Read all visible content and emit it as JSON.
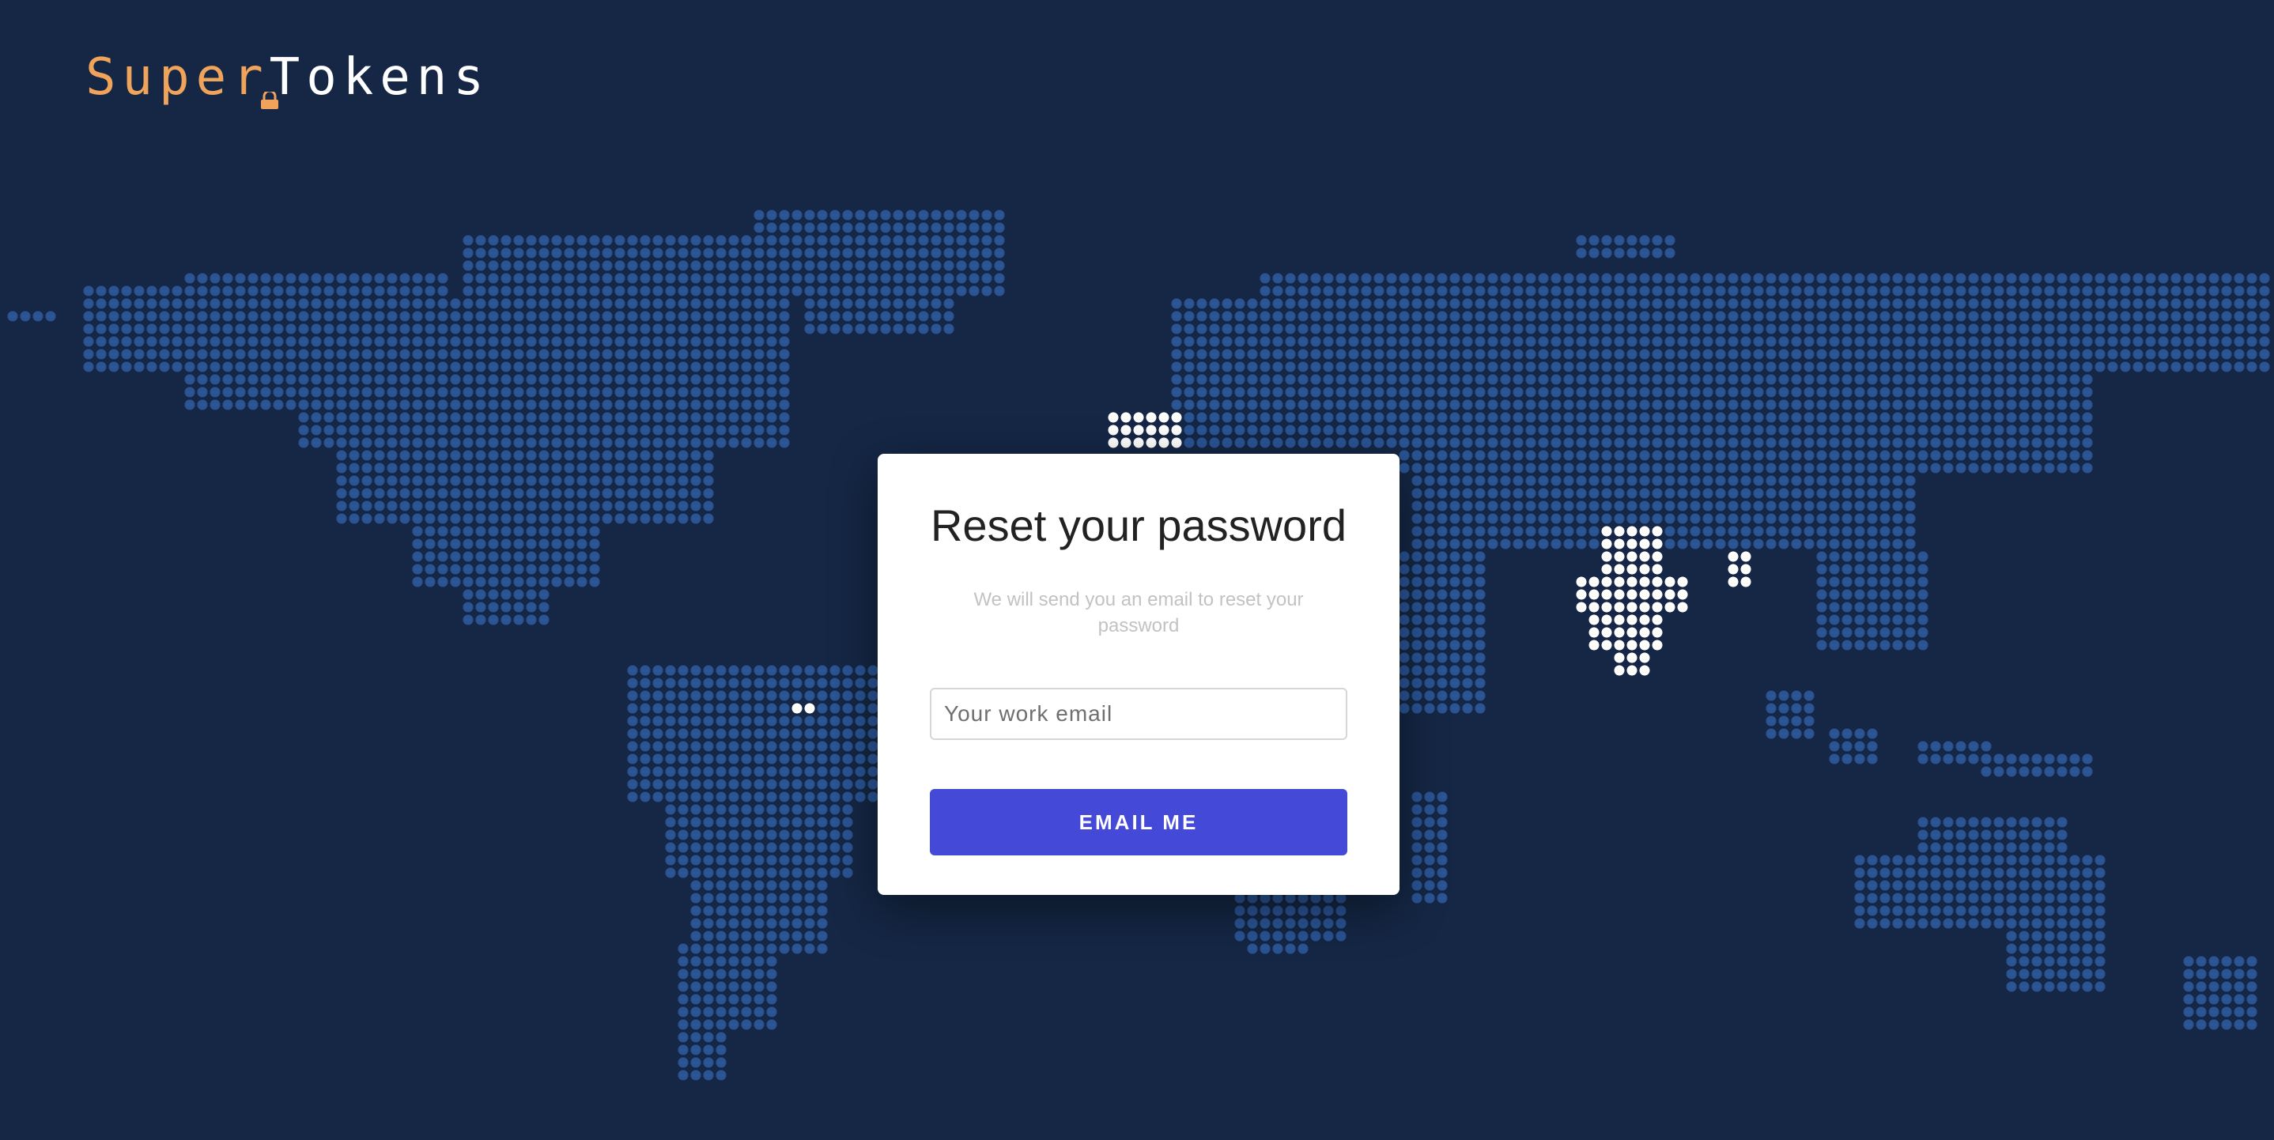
{
  "colors": {
    "background": "#152745",
    "map_dot": "#2a5494",
    "highlight_dot": "#ffffff",
    "logo_accent": "#f0a45b",
    "button": "#4449d8"
  },
  "logo": {
    "part1": "Super",
    "part2": "Tokens"
  },
  "reset_form": {
    "title": "Reset your password",
    "subtitle": "We will send you an email to reset your password",
    "email_placeholder": "Your work email",
    "email_value": "",
    "submit_label": "EMAIL ME"
  },
  "map": {
    "description_icon": "world-dot-map",
    "highlighted_regions": [
      "india",
      "north-africa-spain",
      "caribbean"
    ]
  }
}
